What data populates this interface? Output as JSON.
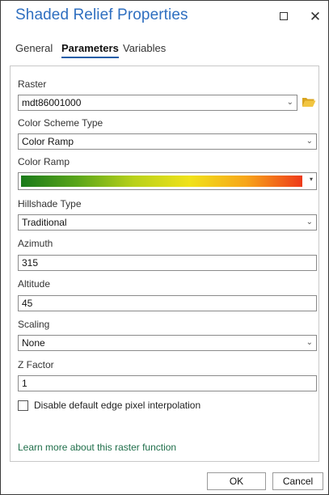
{
  "window": {
    "title": "Shaded Relief Properties",
    "restore_icon": "restore-window-icon",
    "close_glyph": "✕"
  },
  "tabs": [
    {
      "label": "General",
      "active": false
    },
    {
      "label": "Parameters",
      "active": true
    },
    {
      "label": "Variables",
      "active": false
    }
  ],
  "form": {
    "raster": {
      "label": "Raster",
      "value": "mdt86001000"
    },
    "color_scheme_type": {
      "label": "Color Scheme Type",
      "value": "Color Ramp"
    },
    "color_ramp": {
      "label": "Color Ramp",
      "colors": [
        "#1a7a1a",
        "#5aa51a",
        "#b8d11a",
        "#f0e21a",
        "#f7a51a",
        "#ee3a1a"
      ]
    },
    "hillshade_type": {
      "label": "Hillshade Type",
      "value": "Traditional"
    },
    "azimuth": {
      "label": "Azimuth",
      "value": "315"
    },
    "altitude": {
      "label": "Altitude",
      "value": "45"
    },
    "scaling": {
      "label": "Scaling",
      "value": "None"
    },
    "z_factor": {
      "label": "Z Factor",
      "value": "1"
    },
    "disable_interpolation": {
      "label": "Disable default edge pixel interpolation",
      "checked": false
    }
  },
  "learn_more": "Learn more about this raster function",
  "buttons": {
    "ok": "OK",
    "cancel": "Cancel"
  },
  "colors": {
    "accent": "#2f6fc0",
    "link": "#1f6e4a",
    "folder": "#e8b830"
  }
}
